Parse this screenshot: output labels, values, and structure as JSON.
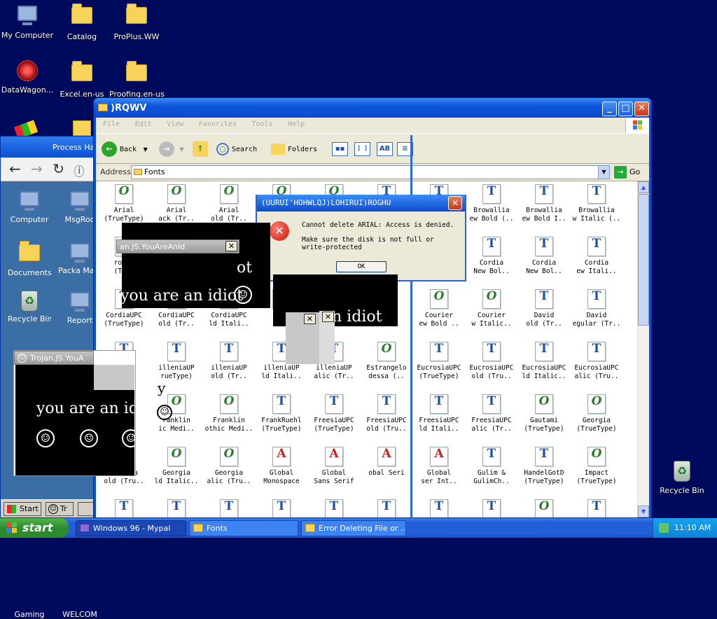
{
  "desktop": {
    "icons": [
      {
        "label": "My Computer",
        "icon": "computer-icon"
      },
      {
        "label": "Catalog",
        "icon": "folder-icon"
      },
      {
        "label": "ProPlus.WW",
        "icon": "folder-icon"
      },
      {
        "label": "DataWagon...",
        "icon": "web-icon"
      },
      {
        "label": "Excel.en-us",
        "icon": "folder-icon"
      },
      {
        "label": "Proofing.en-us",
        "icon": "folder-icon"
      },
      {
        "label": "Recycle Bin",
        "icon": "recycle-bin-icon"
      }
    ]
  },
  "back_window": {
    "title": "Process Hac",
    "nav": {
      "back": "←",
      "forward": "→",
      "refresh": "↻",
      "info": "i"
    },
    "icons": [
      {
        "label": "Computer"
      },
      {
        "label": "MsgRoo"
      },
      {
        "label": "Documents"
      },
      {
        "label": "Packa Manag"
      },
      {
        "label": "Recycle Bin"
      },
      {
        "label": "Report"
      },
      {
        "label": "Gaming"
      },
      {
        "label": "WELCOM"
      }
    ],
    "taskbar": {
      "start": "Start",
      "item": "Tr"
    }
  },
  "explorer": {
    "title": ")RQWV",
    "menu": [
      "File",
      "Edit",
      "View",
      "Favorites",
      "Tools",
      "Help"
    ],
    "toolbar": {
      "back": "Back",
      "search": "Search",
      "folders": "Folders"
    },
    "address_label": "Address",
    "address_value": "Fonts",
    "go": "Go",
    "fonts": [
      {
        "name": "Arial",
        "sub": "(TrueType)",
        "type": "O"
      },
      {
        "name": "Arial",
        "sub": "ack (Tr..",
        "type": "O"
      },
      {
        "name": "Arial",
        "sub": "old (Tr..",
        "type": "O"
      },
      {
        "name": "",
        "sub": "",
        "type": "O"
      },
      {
        "name": "",
        "sub": "",
        "type": "O"
      },
      {
        "name": "",
        "sub": "",
        "type": "T"
      },
      {
        "name": "",
        "sub": "",
        "type": "T"
      },
      {
        "name": "Browallia",
        "sub": "ew Bold (..",
        "type": "T"
      },
      {
        "name": "Browallia",
        "sub": "ew Bold I..",
        "type": "T"
      },
      {
        "name": "Browallia",
        "sub": "w Italic (..",
        "type": "T"
      },
      {
        "name": "rowal",
        "sub": "(True",
        "type": "O"
      },
      {
        "name": "",
        "sub": "",
        "type": "T"
      },
      {
        "name": "",
        "sub": "",
        "type": "T"
      },
      {
        "name": "",
        "sub": "",
        "type": "T"
      },
      {
        "name": "",
        "sub": "",
        "type": "T"
      },
      {
        "name": "",
        "sub": "",
        "type": "T"
      },
      {
        "name": "",
        "sub": "",
        "type": "T"
      },
      {
        "name": "Cordia",
        "sub": "New Bol..",
        "type": "T"
      },
      {
        "name": "Cordia",
        "sub": "New Bol..",
        "type": "T"
      },
      {
        "name": "Cordia",
        "sub": "ew Itali..",
        "type": "T"
      },
      {
        "name": "CordiaUPC",
        "sub": "(TrueType)",
        "type": "T"
      },
      {
        "name": "CordiaUPC",
        "sub": "old (Tr..",
        "type": "T"
      },
      {
        "name": "CordiaUPC",
        "sub": "ld Itali..",
        "type": "T"
      },
      {
        "name": "Cor",
        "sub": "ali",
        "type": "T"
      },
      {
        "name": "",
        "sub": "",
        "type": "T"
      },
      {
        "name": "r",
        "sub": "",
        "type": "T"
      },
      {
        "name": "Courier",
        "sub": "ew Bold ..",
        "type": "O"
      },
      {
        "name": "Courier",
        "sub": "w Italic..",
        "type": "O"
      },
      {
        "name": "David",
        "sub": "old (Tr..",
        "type": "T"
      },
      {
        "name": "David",
        "sub": "egular (Tr..",
        "type": "T"
      },
      {
        "name": "",
        "sub": "",
        "type": "T"
      },
      {
        "name": "illeniaUP",
        "sub": "rueType)",
        "type": "T"
      },
      {
        "name": "illeniaUP",
        "sub": "old (Tr..",
        "type": "T"
      },
      {
        "name": "illeniaUP",
        "sub": "ld Itali..",
        "type": "T"
      },
      {
        "name": "illeniaUP",
        "sub": "alic (Tr..",
        "type": "T"
      },
      {
        "name": "Estrangelo",
        "sub": "dessa (..",
        "type": "O"
      },
      {
        "name": "EucrosiaUPC",
        "sub": "(TrueType)",
        "type": "T"
      },
      {
        "name": "EucrosiaUPC",
        "sub": "old (Tru..",
        "type": "T"
      },
      {
        "name": "EucrosiaUPC",
        "sub": "ld Italic..",
        "type": "T"
      },
      {
        "name": "EucrosiaUPC",
        "sub": "alic (Tru..",
        "type": "T"
      },
      {
        "name": "",
        "sub": "",
        "type": "O"
      },
      {
        "name": "ranklin",
        "sub": "ic Medi..",
        "type": "O"
      },
      {
        "name": "Franklin",
        "sub": "othic Medi..",
        "type": "O"
      },
      {
        "name": "FrankRuehl",
        "sub": "(TrueType)",
        "type": "T"
      },
      {
        "name": "FreesiaUPC",
        "sub": "(TrueType)",
        "type": "T"
      },
      {
        "name": "FreesiaUPC",
        "sub": "old (Tru..",
        "type": "T"
      },
      {
        "name": "FreesiaUPC",
        "sub": "ld Itali..",
        "type": "T"
      },
      {
        "name": "FreesiaUPC",
        "sub": "alic (Tr..",
        "type": "T"
      },
      {
        "name": "Gautami",
        "sub": "(TrueType)",
        "type": "O"
      },
      {
        "name": "Georgia",
        "sub": "(TrueType)",
        "type": "O"
      },
      {
        "name": "Georgia",
        "sub": "old (Tru..",
        "type": "O"
      },
      {
        "name": "Georgia",
        "sub": "ld Italic..",
        "type": "O"
      },
      {
        "name": "Georgia",
        "sub": "alic (Tru..",
        "type": "O"
      },
      {
        "name": "Global",
        "sub": "Monospace",
        "type": "A"
      },
      {
        "name": "Global",
        "sub": "Sans Serif",
        "type": "A"
      },
      {
        "name": "",
        "sub": "obal Seri",
        "type": "A"
      },
      {
        "name": "Global",
        "sub": "ser Int..",
        "type": "A"
      },
      {
        "name": "Gulim &",
        "sub": "GulimCh..",
        "type": "T"
      },
      {
        "name": "HandelGotD",
        "sub": "(TrueType)",
        "type": "T"
      },
      {
        "name": "Impact",
        "sub": "(TrueType)",
        "type": "O"
      },
      {
        "name": "",
        "sub": "",
        "type": "T"
      },
      {
        "name": "",
        "sub": "",
        "type": "T"
      },
      {
        "name": "",
        "sub": "",
        "type": "T"
      },
      {
        "name": "",
        "sub": "",
        "type": "T"
      },
      {
        "name": "",
        "sub": "",
        "type": "T"
      },
      {
        "name": "",
        "sub": "",
        "type": "T"
      },
      {
        "name": "",
        "sub": "",
        "type": "T"
      },
      {
        "name": "",
        "sub": "",
        "type": "T"
      },
      {
        "name": "",
        "sub": "",
        "type": "O"
      },
      {
        "name": "",
        "sub": "",
        "type": "T"
      }
    ]
  },
  "error_dialog": {
    "title": "(UURUI'HOHWLQJ)LOHIRUI)ROGHU",
    "line1": "Cannot delete ARIAL: Access is denied.",
    "line2": "Make sure the disk is not full or",
    "line3": "write-protected",
    "ok": "OK"
  },
  "trojans": {
    "title_a": "an.JS.YouAreAnId",
    "title_b": "Trojan.JS.YouA",
    "message": "you are an idiot",
    "fragment_ot": "ot",
    "fragment_idiot": "n idiot",
    "fragment_y": "y",
    "smiley": "☺"
  },
  "desktop_right": {
    "recycle_label": "Recycle Bin"
  },
  "taskbar": {
    "start": "start",
    "items": [
      {
        "label": "Windows 96 - Mypal"
      },
      {
        "label": "Fonts"
      },
      {
        "label": "Error Deleting File or ..."
      }
    ],
    "clock": "11:10 AM"
  },
  "colors": {
    "desktop": "#000a5c",
    "xp_blue": "#0b4bd0",
    "taskbar_green": "#2c8c2c"
  }
}
